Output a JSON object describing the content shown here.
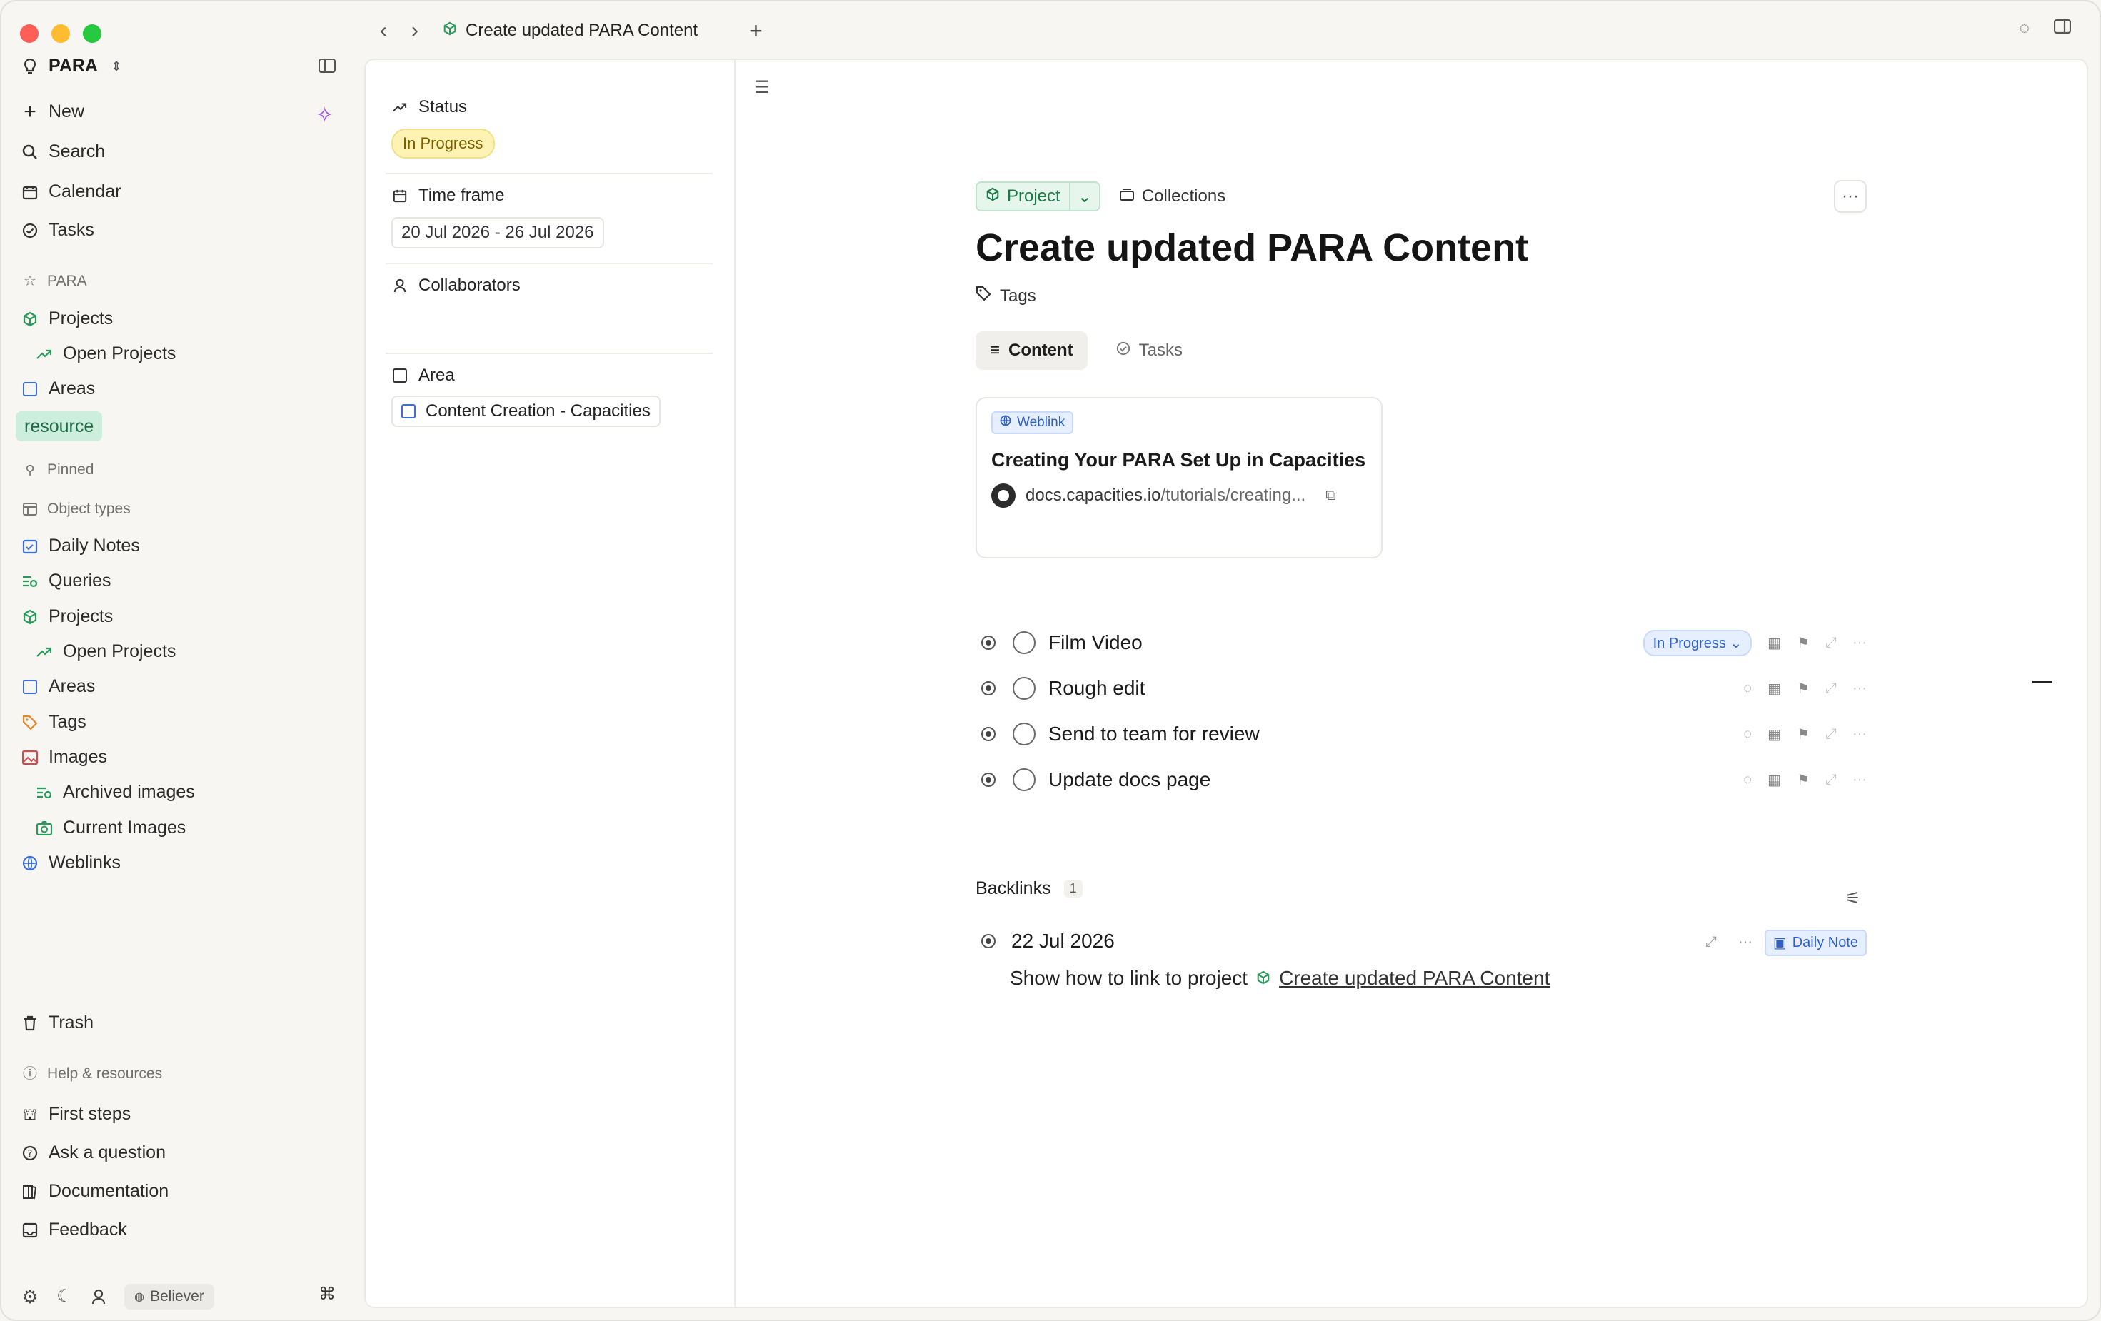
{
  "window": {
    "tab_title": "Create updated PARA Content"
  },
  "sidebar": {
    "workspace": "PARA",
    "primary": [
      {
        "label": "New",
        "icon": "plus-icon"
      },
      {
        "label": "Search",
        "icon": "search-icon"
      },
      {
        "label": "Calendar",
        "icon": "calendar-icon"
      },
      {
        "label": "Tasks",
        "icon": "check-circle-icon"
      }
    ],
    "para_header": "PARA",
    "para_items": [
      {
        "label": "Projects"
      },
      {
        "label": "Open Projects"
      },
      {
        "label": "Areas"
      },
      {
        "label": "resource"
      }
    ],
    "pinned_header": "Pinned",
    "object_types_header": "Object types",
    "object_types": [
      {
        "label": "Daily Notes"
      },
      {
        "label": "Queries"
      },
      {
        "label": "Projects"
      },
      {
        "label": "Open Projects"
      },
      {
        "label": "Areas"
      },
      {
        "label": "Tags"
      },
      {
        "label": "Images"
      },
      {
        "label": "Archived images"
      },
      {
        "label": "Current Images"
      },
      {
        "label": "Weblinks"
      }
    ],
    "trash": "Trash",
    "help_header": "Help & resources",
    "help_items": [
      {
        "label": "First steps"
      },
      {
        "label": "Ask a question"
      },
      {
        "label": "Documentation"
      },
      {
        "label": "Feedback"
      }
    ],
    "plan_badge": "Believer",
    "cmd_glyph": "⌘"
  },
  "properties": {
    "status_label": "Status",
    "status_value": "In Progress",
    "timeframe_label": "Time frame",
    "timeframe_value": "20 Jul 2026 - 26 Jul 2026",
    "collaborators_label": "Collaborators",
    "area_label": "Area",
    "area_value": "Content Creation - Capacities"
  },
  "doc": {
    "type_label": "Project",
    "collections_label": "Collections",
    "title": "Create updated PARA Content",
    "tags_label": "Tags",
    "tabs": [
      {
        "label": "Content"
      },
      {
        "label": "Tasks"
      }
    ],
    "weblink": {
      "badge": "Weblink",
      "title": "Creating Your PARA Set Up in Capacities",
      "url_domain": "docs.capacities.io",
      "url_path": "/tutorials/creating..."
    },
    "tasks": [
      {
        "label": "Film Video",
        "status": "In Progress"
      },
      {
        "label": "Rough edit"
      },
      {
        "label": "Send to team for review"
      },
      {
        "label": "Update docs page"
      }
    ],
    "backlinks": {
      "label": "Backlinks",
      "count": "1",
      "entry_date": "22 Jul 2026",
      "entry_text": "Show how to link to project",
      "entry_link": "Create updated PARA Content",
      "entry_type": "Daily Note"
    }
  },
  "colors": {
    "accent_green": "#1b7a45",
    "accent_blue": "#2f5fc6",
    "status_yellow": "#fff3b3",
    "sparkle_purple": "#a34cf0"
  }
}
